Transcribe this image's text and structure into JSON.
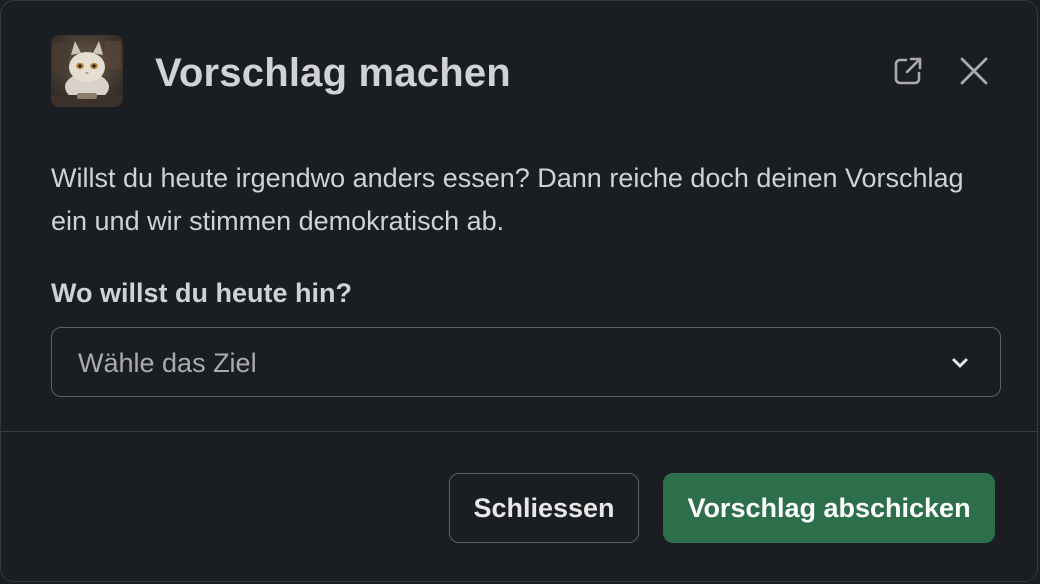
{
  "modal": {
    "title": "Vorschlag machen",
    "app_avatar_icon": "cat-avatar-icon",
    "external_icon": "open-in-new-window-icon",
    "close_icon": "close-icon"
  },
  "form": {
    "description": "Willst du heute irgendwo anders essen? Dann reiche doch deinen Vorschlag ein und wir stimmen demokratisch ab.",
    "destination_label": "Wo willst du heute hin?",
    "destination_placeholder": "Wähle das Ziel",
    "destination_icon": "chevron-down-icon"
  },
  "footer": {
    "close_label": "Schliessen",
    "submit_label": "Vorschlag abschicken"
  },
  "colors": {
    "background": "#1a1d21",
    "primary_button": "#2d6e4b",
    "text": "#d1d2d3"
  }
}
